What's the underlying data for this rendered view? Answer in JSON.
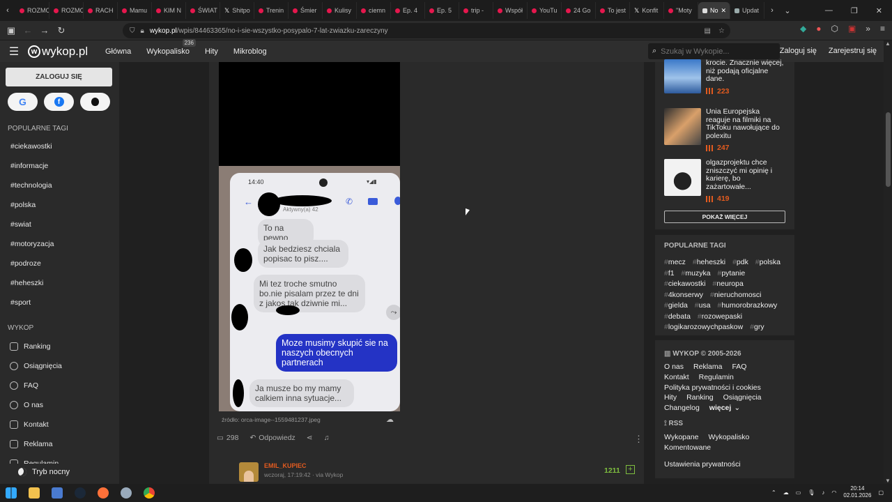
{
  "tabs": [
    {
      "label": "ROZMO",
      "icon": "youtube-icon"
    },
    {
      "label": "ROZMO",
      "icon": "youtube-icon"
    },
    {
      "label": "RACH",
      "icon": "youtube-icon"
    },
    {
      "label": "Mamu",
      "icon": "youtube-icon"
    },
    {
      "label": "KIM N",
      "icon": "youtube-icon"
    },
    {
      "label": "ŚWIAT",
      "icon": "youtube-icon"
    },
    {
      "label": "Shitpo",
      "icon": "x-icon"
    },
    {
      "label": "Trenin",
      "icon": "youtube-icon"
    },
    {
      "label": "Śmier",
      "icon": "youtube-icon"
    },
    {
      "label": "Kulisy",
      "icon": "youtube-icon"
    },
    {
      "label": "ciemn",
      "icon": "youtube-icon"
    },
    {
      "label": "Ep. 4",
      "icon": "youtube-icon"
    },
    {
      "label": "Ep. 5",
      "icon": "youtube-icon"
    },
    {
      "label": "trip -",
      "icon": "youtube-icon"
    },
    {
      "label": "Współ",
      "icon": "youtube-icon"
    },
    {
      "label": "YouTu",
      "icon": "youtube-icon"
    },
    {
      "label": "24 Go",
      "icon": "youtube-icon"
    },
    {
      "label": "To jest",
      "icon": "youtube-icon"
    },
    {
      "label": "Konfit",
      "icon": "x-icon"
    },
    {
      "label": "\"Moty",
      "icon": "youtube-icon"
    },
    {
      "label": "No",
      "icon": "wykop-icon",
      "active": true
    },
    {
      "label": "Updat",
      "icon": "update-icon"
    }
  ],
  "address": {
    "domain": "wykop.pl",
    "path": "/wpis/84463365/no-i-sie-wszystko-posypalo-7-lat-zwiazku-zareczyny"
  },
  "nav": {
    "logo": "wykop.pl",
    "links": [
      "Główna",
      "Wykopalisko",
      "Hity",
      "Mikroblog"
    ],
    "wykopalisko_badge": "236",
    "search_placeholder": "Szukaj w Wykopie...",
    "login": "Zaloguj się",
    "register": "Zarejestruj się"
  },
  "sidebar": {
    "login_button": "ZALOGUJ SIĘ",
    "popular_tags_title": "POPULARNE TAGI",
    "tags": [
      "#ciekawostki",
      "#informacje",
      "#technologia",
      "#polska",
      "#swiat",
      "#motoryzacja",
      "#podroze",
      "#heheszki",
      "#sport"
    ],
    "wykop_title": "WYKOP",
    "items": [
      "Ranking",
      "Osiągnięcia",
      "FAQ",
      "O nas",
      "Kontakt",
      "Reklama",
      "Regulamin"
    ],
    "night_mode": "Tryb nocny"
  },
  "post": {
    "screenshot": {
      "time": "14:40",
      "status_sub": "Aktywny(a) 42",
      "msg1": "To na pewno",
      "msg2": "Jak bedziesz chciala popisac to pisz....",
      "msg3": "Mi tez troche smutno bo.nie pisalam przez te dni z        jakos tak dziwnie mi...",
      "msg4": "Moze musimy skupić sie na naszych obecnych partnerach",
      "msg5": "Ja musze bo my mamy calkiem inna sytuacje..."
    },
    "source": "źródło: orca-image--1559481237.jpeg",
    "comments_count": "298",
    "reply": "Odpowiedz"
  },
  "comment": {
    "user": "EMIL_KUPIEC",
    "meta": "wczoraj, 17:19:42 · via Wykop",
    "score": "1211"
  },
  "right": {
    "cards": [
      {
        "text": "krocie. Znacznie więcej, niż podają oficjalne dane.",
        "votes": "223"
      },
      {
        "text": "Unia Europejska reaguje na filmiki na TikToku nawołujące do polexitu",
        "votes": "247"
      },
      {
        "text": "olgazprojektu chce zniszczyć mi opinię i karierę, bo zażartowałe...",
        "votes": "419"
      }
    ],
    "show_more": "POKAŻ WIĘCEJ",
    "popular_tags_title": "POPULARNE TAGI",
    "popular_tags": [
      "mecz",
      "heheszki",
      "pdk",
      "polska",
      "f1",
      "muzyka",
      "pytanie",
      "ciekawostki",
      "neuropa",
      "4konserwy",
      "nieruchomosci",
      "gielda",
      "usa",
      "humorobrazkowy",
      "debata",
      "rozowepaski",
      "logikarozowychpaskow",
      "gry"
    ],
    "footer_title": "WYKOP © 2005-2026",
    "footer_links": [
      "O nas",
      "Reklama",
      "FAQ",
      "Kontakt",
      "Regulamin",
      "Polityka prywatności i cookies",
      "Hity",
      "Ranking",
      "Osiągnięcia",
      "Changelog",
      "więcej"
    ],
    "rss_title": "RSS",
    "rss_links": [
      "Wykopane",
      "Wykopalisko",
      "Komentowane"
    ],
    "privacy_settings": "Ustawienia prywatności"
  },
  "taskbar": {
    "time": "20:14",
    "date": "02.01.2026"
  }
}
